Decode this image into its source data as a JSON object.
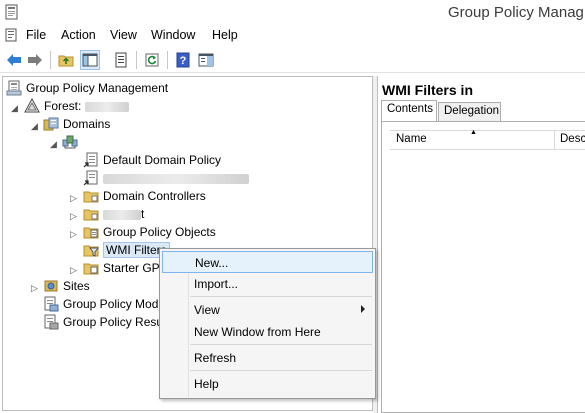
{
  "window": {
    "title": "Group Policy Manag"
  },
  "menubar": {
    "items": [
      "File",
      "Action",
      "View",
      "Window",
      "Help"
    ]
  },
  "toolbar": {
    "buttons": [
      "back-icon",
      "forward-icon",
      "up-folder-icon",
      "show-hide-tree-icon",
      "properties-icon",
      "refresh-icon",
      "help-icon",
      "action-pane-icon"
    ]
  },
  "tree": {
    "root": "Group Policy Management",
    "forest": "Forest: ",
    "domains": "Domains",
    "domain_name": "",
    "default_domain_policy": "Default Domain Policy",
    "obscured_policy": "",
    "domain_controllers": "Domain Controllers",
    "obscured_ou": "t",
    "group_policy_objects": "Group Policy Objects",
    "wmi_filters": "WMI Filters",
    "starter_gpos": "Starter GPO",
    "sites": "Sites",
    "group_policy_modeling": "Group Policy Mod",
    "group_policy_results": "Group Policy Resu"
  },
  "right_pane": {
    "title": "WMI Filters in",
    "tabs": [
      "Contents",
      "Delegation"
    ],
    "columns": [
      "Name",
      "Desc"
    ]
  },
  "context_menu": {
    "items": [
      "New...",
      "Import...",
      "View",
      "New Window from Here",
      "Refresh",
      "Help"
    ]
  }
}
